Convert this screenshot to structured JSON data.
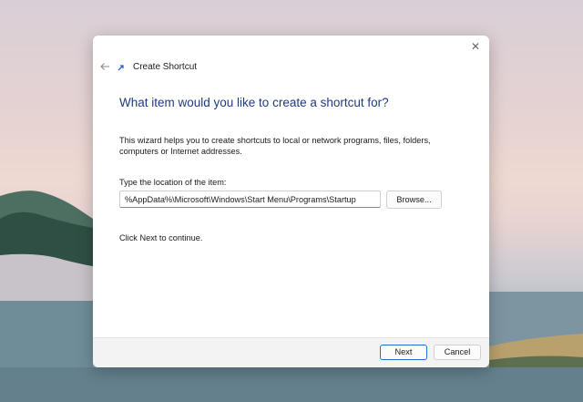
{
  "window": {
    "title": "Create Shortcut",
    "close_glyph": "✕",
    "back_glyph": "←"
  },
  "content": {
    "heading": "What item would you like to create a shortcut for?",
    "description": "This wizard helps you to create shortcuts to local or network programs, files, folders, computers or Internet addresses.",
    "location_label": "Type the location of the item:",
    "location_value": "%AppData%\\Microsoft\\Windows\\Start Menu\\Programs\\Startup",
    "browse_label": "Browse...",
    "continue_text": "Click Next to continue."
  },
  "footer": {
    "next_label": "Next",
    "cancel_label": "Cancel"
  },
  "icons": {
    "back": "back-arrow-icon",
    "shortcut": "shortcut-arrow-icon",
    "close": "close-icon"
  },
  "colors": {
    "heading": "#1e3a80",
    "accent": "#1f6fd0",
    "footer_bg": "#f3f3f3"
  }
}
